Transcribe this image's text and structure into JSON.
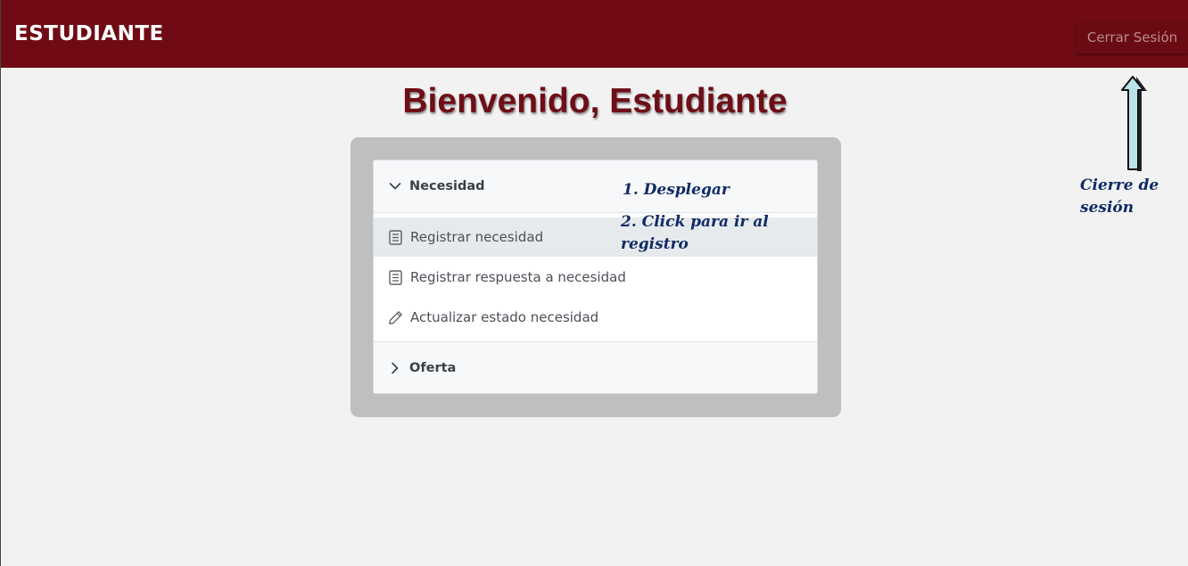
{
  "header": {
    "brand": "ESTUDIANTE",
    "logout_label": "Cerrar Sesión"
  },
  "main": {
    "title": "Bienvenido, Estudiante"
  },
  "menu": {
    "sections": [
      {
        "label": "Necesidad",
        "expanded": true,
        "items": [
          {
            "label": "Registrar necesidad",
            "icon": "document-icon",
            "active": true
          },
          {
            "label": "Registrar respuesta a necesidad",
            "icon": "document-icon",
            "active": false
          },
          {
            "label": "Actualizar estado necesidad",
            "icon": "pencil-icon",
            "active": false
          }
        ]
      },
      {
        "label": "Oferta",
        "expanded": false,
        "items": []
      }
    ]
  },
  "annotations": {
    "step1": "1. Desplegar",
    "step2": "2. Click para ir al registro",
    "logout_note": "Cierre de sesión"
  },
  "colors": {
    "header_bg": "#700b15",
    "title": "#6e0e17",
    "annotation": "#0f2a66",
    "panel_bg": "#bfbfbf",
    "active_item_bg": "#e7eaec"
  }
}
